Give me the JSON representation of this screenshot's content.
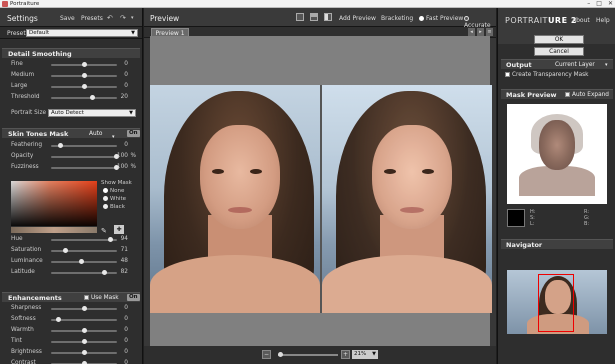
{
  "window": {
    "title": "Portraiture"
  },
  "left": {
    "title": "Settings",
    "save": "Save",
    "presets": "Presets",
    "preset_label": "Preset",
    "preset_value": "Default",
    "detail": {
      "title": "Detail Smoothing",
      "sliders": [
        {
          "name": "Fine",
          "value": "0",
          "level": 0.5
        },
        {
          "name": "Medium",
          "value": "0",
          "level": 0.5
        },
        {
          "name": "Large",
          "value": "0",
          "level": 0.5
        },
        {
          "name": "Threshold",
          "value": "20",
          "level": 0.62
        }
      ],
      "portrait_size_label": "Portrait Size",
      "portrait_size_value": "Auto Detect"
    },
    "skin": {
      "title": "Skin Tones Mask",
      "mode": "Auto",
      "on": "On",
      "sliders": [
        {
          "name": "Feathering",
          "value": "0",
          "level": 0.12
        },
        {
          "name": "Opacity",
          "value": "100",
          "unit": "%",
          "level": 1.0
        },
        {
          "name": "Fuzziness",
          "value": "100",
          "unit": "%",
          "level": 1.0
        }
      ],
      "show_mask": "Show Mask",
      "mask_options": [
        "None",
        "White",
        "Black"
      ],
      "tone_sliders": [
        {
          "name": "Hue",
          "value": "94",
          "level": 0.9
        },
        {
          "name": "Saturation",
          "value": "71",
          "level": 0.2
        },
        {
          "name": "Luminance",
          "value": "48",
          "level": 0.45
        },
        {
          "name": "Latitude",
          "value": "82",
          "level": 0.82
        }
      ]
    },
    "enh": {
      "title": "Enhancements",
      "use_mask": "Use Mask",
      "on": "On",
      "sliders": [
        {
          "name": "Sharpness",
          "value": "0",
          "level": 0.5
        },
        {
          "name": "Softness",
          "value": "0",
          "level": 0.1
        },
        {
          "name": "Warmth",
          "value": "0",
          "level": 0.5
        },
        {
          "name": "Tint",
          "value": "0",
          "level": 0.5
        },
        {
          "name": "Brightness",
          "value": "0",
          "level": 0.5
        },
        {
          "name": "Contrast",
          "value": "0",
          "level": 0.5
        }
      ]
    }
  },
  "center": {
    "title": "Preview",
    "add_preview": "Add Preview",
    "bracketing": "Bracketing",
    "fast_preview": "Fast Preview",
    "accurate": "Accurate",
    "tab": "Preview 1",
    "zoom": "21%"
  },
  "right": {
    "logo_a": "PORTRAIT",
    "logo_b": "URE 2",
    "about": "About",
    "help": "Help",
    "ok": "OK",
    "cancel": "Cancel",
    "output_title": "Output",
    "output_value": "Current Layer",
    "transparency": "Create Transparency Mask",
    "mask_preview": "Mask Preview",
    "auto_expand": "Auto Expand",
    "h": "H:",
    "s": "S:",
    "l": "L:",
    "r": "R:",
    "g": "G:",
    "b": "B:",
    "navigator": "Navigator"
  },
  "colors": {
    "accent": "#e4401a",
    "nav_rect": "#ee0000"
  }
}
